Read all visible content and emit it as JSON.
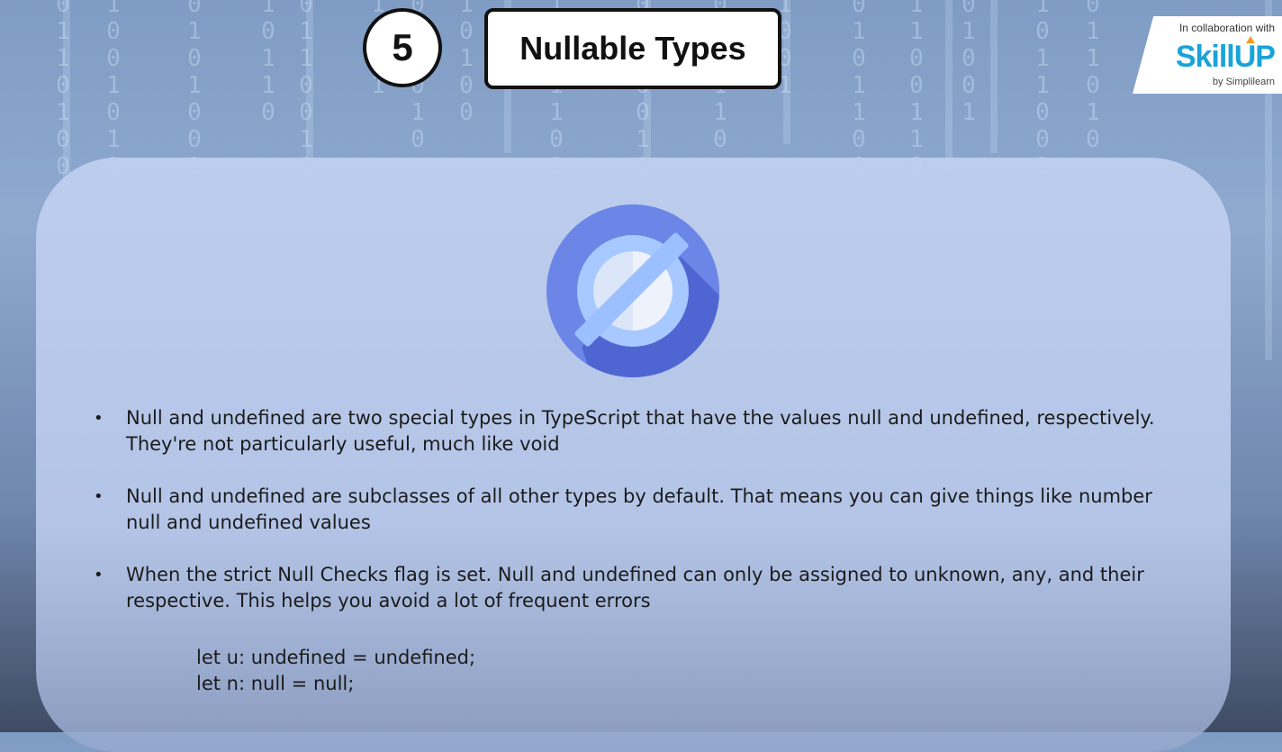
{
  "slide": {
    "number": "5",
    "title": "Nullable Types"
  },
  "logo": {
    "collab_text": "In collaboration with",
    "brand": "SkillUP",
    "by_text": "by Simplilearn",
    "brand_color": "#1aa3d8",
    "arrow_color": "#f39c1f"
  },
  "icon": {
    "name": "null-symbol-icon"
  },
  "bullets": [
    "Null and undefined are two special types in TypeScript that have the values null and undefined, respectively. They're not particularly useful, much like void",
    "Null and undefined are subclasses of all other types by default. That means you can give things like number null and undefined values",
    "When the strict Null Checks flag is set. Null and undefined can only be assigned to unknown, any, and their respective. This helps you avoid a lot of frequent errors"
  ],
  "code_lines": [
    "let u: undefined = undefined;",
    "let n: null = null;"
  ]
}
